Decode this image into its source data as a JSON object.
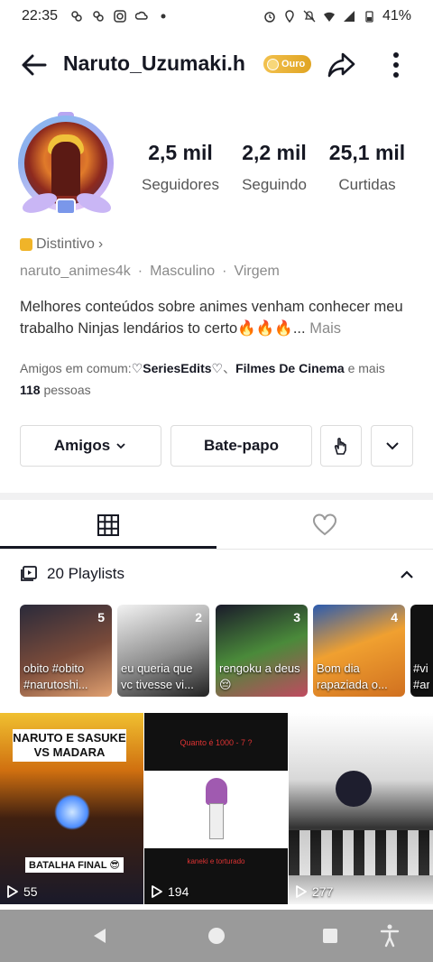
{
  "status_bar": {
    "time": "22:35",
    "battery": "41%"
  },
  "header": {
    "username": "Naruto_Uzumaki.h",
    "badge": "Ouro"
  },
  "stats": [
    {
      "value": "2,5 mil",
      "label": "Seguidores"
    },
    {
      "value": "2,2 mil",
      "label": "Seguindo"
    },
    {
      "value": "25,1 mil",
      "label": "Curtidas"
    }
  ],
  "profile": {
    "distintivo": "Distintivo",
    "handle": "naruto_animes4k",
    "gender": "Masculino",
    "sign": "Virgem",
    "bio": "Melhores conteúdos sobre animes venham conhecer meu trabalho Ninjas lendários to certo🔥🔥🔥...",
    "bio_more": "Mais",
    "friends_prefix": "Amigos em comum:",
    "friend1": "♡SeriesEdits♡",
    "friends_sep": "、",
    "friend2": "Filmes De Cinema",
    "friends_and": " e mais ",
    "friends_count": "118",
    "friends_suffix": " pessoas"
  },
  "actions": {
    "amigos": "Amigos",
    "chat": "Bate-papo"
  },
  "playlists": {
    "header": "20 Playlists",
    "items": [
      {
        "num": "5",
        "title": "obito #obito #narutoshi..."
      },
      {
        "num": "2",
        "title": "eu queria que vc tivesse vi..."
      },
      {
        "num": "3",
        "title": "rengoku a deus😔"
      },
      {
        "num": "4",
        "title": "Bom dia rapaziada o..."
      },
      {
        "num": "",
        "title": "#vi #ar"
      }
    ]
  },
  "videos": [
    {
      "views": "55",
      "caption_top": "NARUTO E SASUKE VS MADARA",
      "caption_bottom": "BATALHA FINAL 😎"
    },
    {
      "views": "194",
      "caption_top": "Quanto é 1000 - 7 ?",
      "caption_bottom": "kaneki e torturado"
    },
    {
      "views": "277"
    }
  ],
  "colors": {
    "text": "#161823",
    "muted": "#8a8a8a",
    "gold": "#e0a422",
    "navbar": "#9a9a9a"
  },
  "icons": {
    "back": "arrow-left-icon",
    "share": "share-arrow-icon",
    "more": "vertical-dots-icon",
    "grid": "grid-icon",
    "like": "heart-icon",
    "playlist": "playlist-icon",
    "collapse": "chevron-up-icon",
    "play": "play-icon"
  }
}
